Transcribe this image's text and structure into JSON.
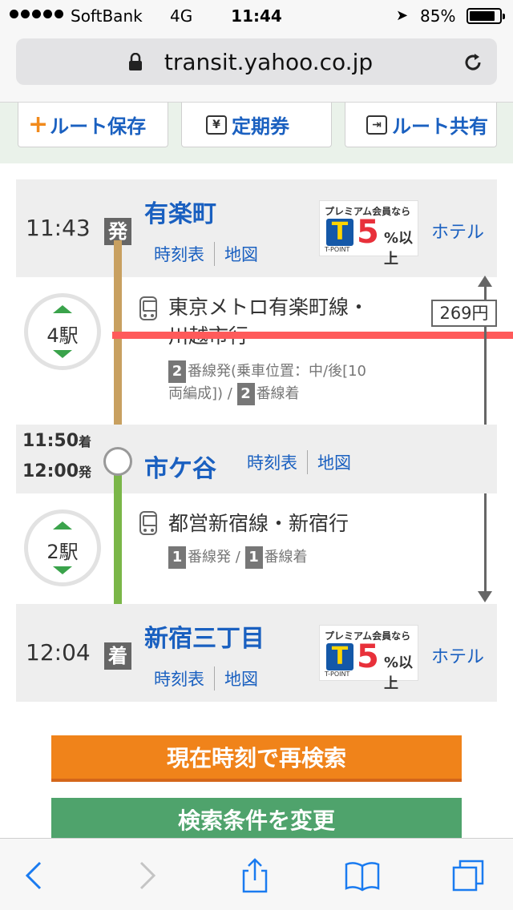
{
  "status": {
    "carrier": "SoftBank",
    "network": "4G",
    "time": "11:44",
    "battery": "85%",
    "battery_level": 0.85
  },
  "browser": {
    "url": "transit.yahoo.co.jp"
  },
  "actions": {
    "save_route": "ルート保存",
    "commuter_pass": "定期券",
    "share_route": "ルート共有",
    "yen_symbol": "¥"
  },
  "route": {
    "fare": "269円",
    "links": {
      "timetable": "時刻表",
      "map": "地図"
    },
    "stations": [
      {
        "name": "有楽町",
        "time": "11:43",
        "badge": "発"
      },
      {
        "name": "市ケ谷",
        "arrive": "11:50",
        "arrive_suffix": "着",
        "depart": "12:00",
        "depart_suffix": "発"
      },
      {
        "name": "新宿三丁目",
        "time": "12:04",
        "badge": "着"
      }
    ],
    "segments": [
      {
        "stops": "4駅",
        "line_1": "東京メトロ有楽町線・",
        "line_2": "川越市行",
        "dep_num": "2",
        "plat_1": "番線発(乗車位置：中/後[10",
        "plat_2a": "両編成]) / ",
        "arr_num": "2",
        "plat_2b": "番線着",
        "color": "#c8a060"
      },
      {
        "stops": "2駅",
        "line_1": "都営新宿線・新宿行",
        "dep_num": "1",
        "plat_a": "番線発 / ",
        "arr_num": "1",
        "plat_b": "番線着",
        "color": "#7ab648"
      }
    ],
    "hotel": "ホテル"
  },
  "ad": {
    "tagline": "プレミアム会員なら",
    "percent": "5",
    "suffix": "%以上",
    "logo_letter": "T",
    "brand": "T-POINT"
  },
  "buttons": {
    "research": "現在時刻で再検索",
    "change": "検索条件を変更"
  },
  "colors": {
    "accent": "#1a60c0",
    "orange": "#f0831a",
    "green": "#4fa36c"
  }
}
